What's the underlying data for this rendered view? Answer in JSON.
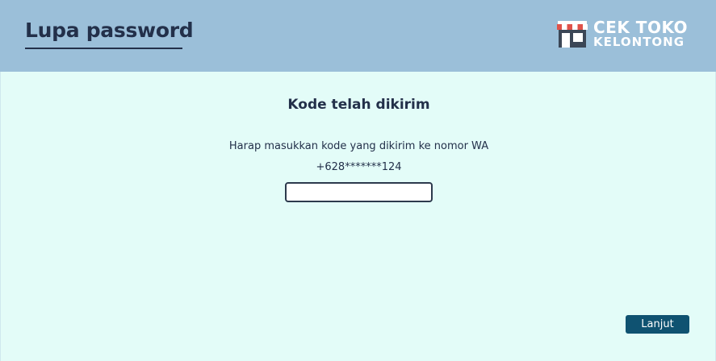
{
  "header": {
    "title": "Lupa password",
    "logo": {
      "line1": "CEK TOKO",
      "line2": "KELONTONG",
      "icon": "store-icon"
    }
  },
  "main": {
    "heading": "Kode telah dikirim",
    "instruction": "Harap masukkan kode yang dikirim ke nomor WA",
    "phone_masked": "+628*******124",
    "code_input": {
      "value": "",
      "placeholder": ""
    },
    "next_button_label": "Lanjut"
  },
  "colors": {
    "header_bg": "#9bbfd9",
    "page_bg": "#e3fcf8",
    "text_dark": "#23304a",
    "button_bg": "#0f5271",
    "logo_awning_red": "#e0524a"
  }
}
